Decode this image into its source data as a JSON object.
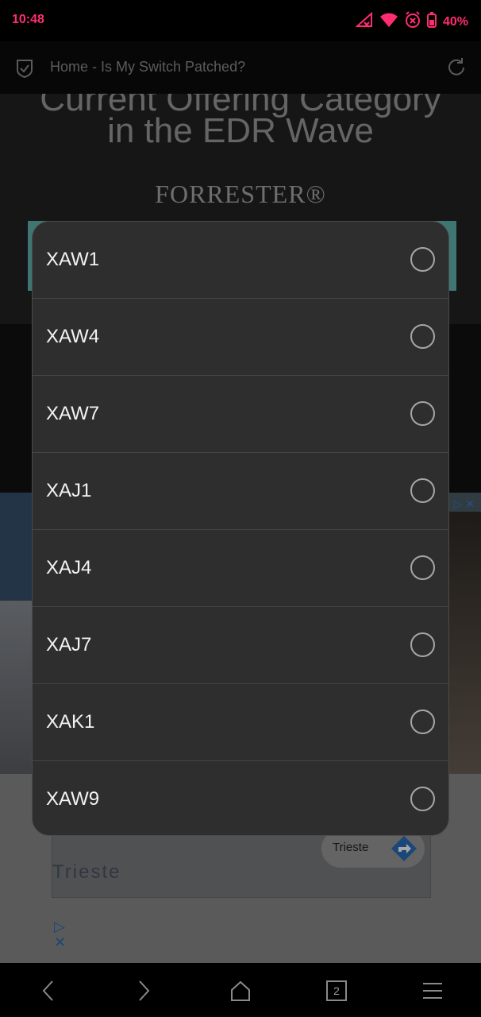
{
  "status_bar": {
    "time": "10:48",
    "battery_percent": "40%",
    "icons": [
      "no-signal-icon",
      "wifi-icon",
      "alarm-off-icon",
      "battery-icon"
    ],
    "accent_color": "#ff2d6f"
  },
  "address_bar": {
    "title": "Home - Is My Switch Patched?",
    "icons": [
      "shield-check-icon",
      "reload-icon"
    ]
  },
  "page": {
    "hero_line_top": "Current Offering Category",
    "hero_line_bottom": "in the EDR Wave",
    "hero_brand": "FORRESTER®",
    "map_label": "Trieste",
    "map_pill_label": "Trieste"
  },
  "dialog": {
    "options": [
      {
        "label": "XAW1",
        "selected": false
      },
      {
        "label": "XAW4",
        "selected": false
      },
      {
        "label": "XAW7",
        "selected": false
      },
      {
        "label": "XAJ1",
        "selected": false
      },
      {
        "label": "XAJ4",
        "selected": false
      },
      {
        "label": "XAJ7",
        "selected": false
      },
      {
        "label": "XAK1",
        "selected": false
      },
      {
        "label": "XAW9",
        "selected": false
      }
    ]
  },
  "nav_bar": {
    "tab_count": "2",
    "icons": [
      "back-icon",
      "forward-icon",
      "home-icon",
      "tabs-icon",
      "menu-icon"
    ]
  }
}
